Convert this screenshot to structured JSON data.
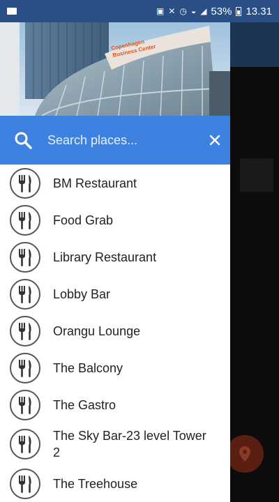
{
  "status_bar": {
    "battery_percent": "53%",
    "time": "13.31",
    "icons": [
      "notification-icon",
      "nfc-icon",
      "mute-icon",
      "alarm-icon",
      "wifi-icon",
      "signal-icon",
      "battery-icon"
    ]
  },
  "header": {
    "building_sign_line1": "Copenhagen",
    "building_sign_line2": "Business Center"
  },
  "search": {
    "placeholder": "Search places..."
  },
  "places": [
    {
      "label": "BM Restaurant"
    },
    {
      "label": "Food Grab"
    },
    {
      "label": "Library Restaurant"
    },
    {
      "label": "Lobby Bar"
    },
    {
      "label": "Orangu Lounge"
    },
    {
      "label": "The Balcony"
    },
    {
      "label": "The Gastro"
    },
    {
      "label": "The Sky Bar-23 level Tower 2"
    },
    {
      "label": "The Treehouse"
    }
  ],
  "colors": {
    "search_bar": "#3d82e0",
    "status_bar": "#2a4f86",
    "icon_border": "#555555"
  }
}
